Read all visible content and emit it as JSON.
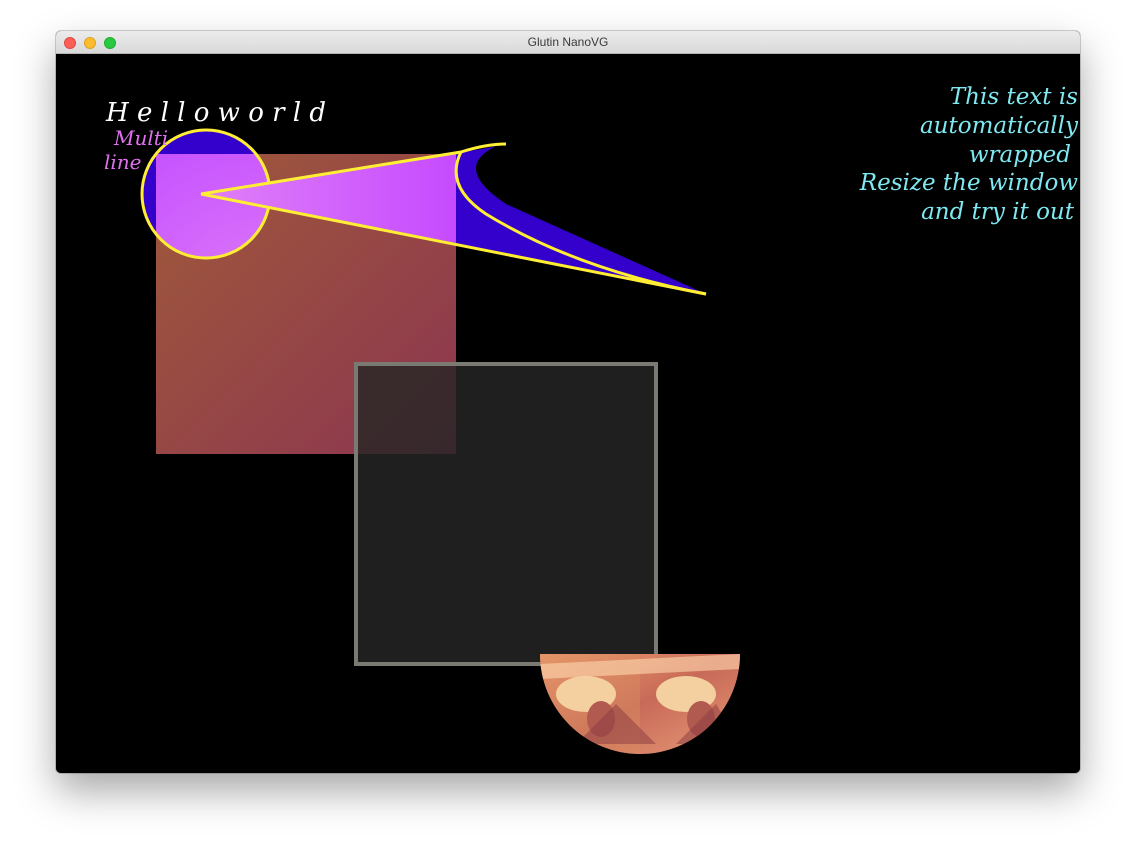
{
  "window": {
    "title": "Glutin NanoVG"
  },
  "canvas": {
    "background": "#000000",
    "hello_text": "H e l l o   w o r l d",
    "hello_color": "#ffffff",
    "multiline": [
      "Multi",
      "line"
    ],
    "multiline_color": "#e070f0",
    "wrapped_text": [
      "This text is",
      "automatically",
      "wrapped",
      "Resize the window",
      "and try it out"
    ],
    "wrapped_color": "#7fe8f0",
    "colors": {
      "gradient_start": "#a05a3a",
      "gradient_end": "#8c3550",
      "shape_fill_light": "#d86cf6",
      "shape_fill_mid": "#c84bff",
      "shape_fill_dark": "#3300cc",
      "outline": "#ffee33",
      "square_fill": "#262626",
      "square_stroke": "#7a7a72",
      "photo_tone": "#d08a60"
    }
  }
}
